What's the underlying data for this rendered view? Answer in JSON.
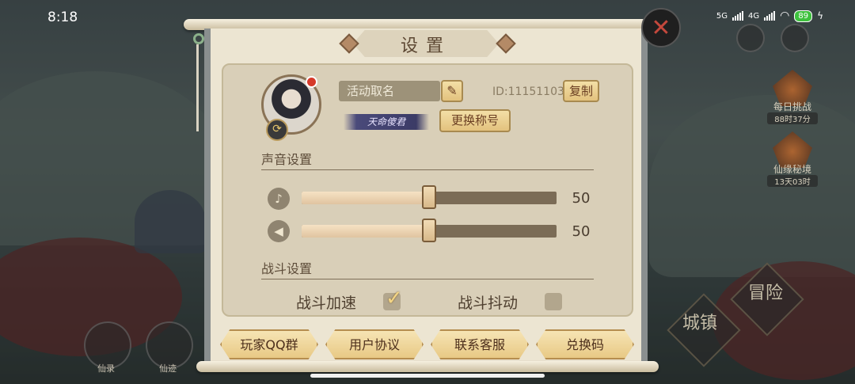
{
  "status_bar": {
    "time": "8:18",
    "sim1": "5G",
    "sim2": "4G",
    "battery": "89"
  },
  "background": {
    "event1_label": "每日挑战",
    "event1_timer": "88时37分",
    "event2_label": "仙缘秘境",
    "event2_timer": "13天03时",
    "btn_left1_label": "仙录",
    "btn_left2_label": "仙迹",
    "adventure_text": "冒险",
    "town_text": "城镇"
  },
  "dialog": {
    "title": "设置",
    "close_symbol": "✕"
  },
  "profile": {
    "name_placeholder": "活动取名",
    "id_text": "ID:11151103",
    "copy_label": "复制",
    "title_badge": "天命傻君",
    "change_title_label": "更换称号"
  },
  "sound": {
    "section_label": "声音设置",
    "music_volume": 50,
    "sfx_volume": 50
  },
  "battle": {
    "section_label": "战斗设置",
    "speedup_label": "战斗加速",
    "speedup_checked": true,
    "shake_label": "战斗抖动",
    "shake_checked": false
  },
  "bottom_buttons": {
    "qq_group": "玩家QQ群",
    "agreement": "用户协议",
    "support": "联系客服",
    "redeem": "兑换码"
  }
}
